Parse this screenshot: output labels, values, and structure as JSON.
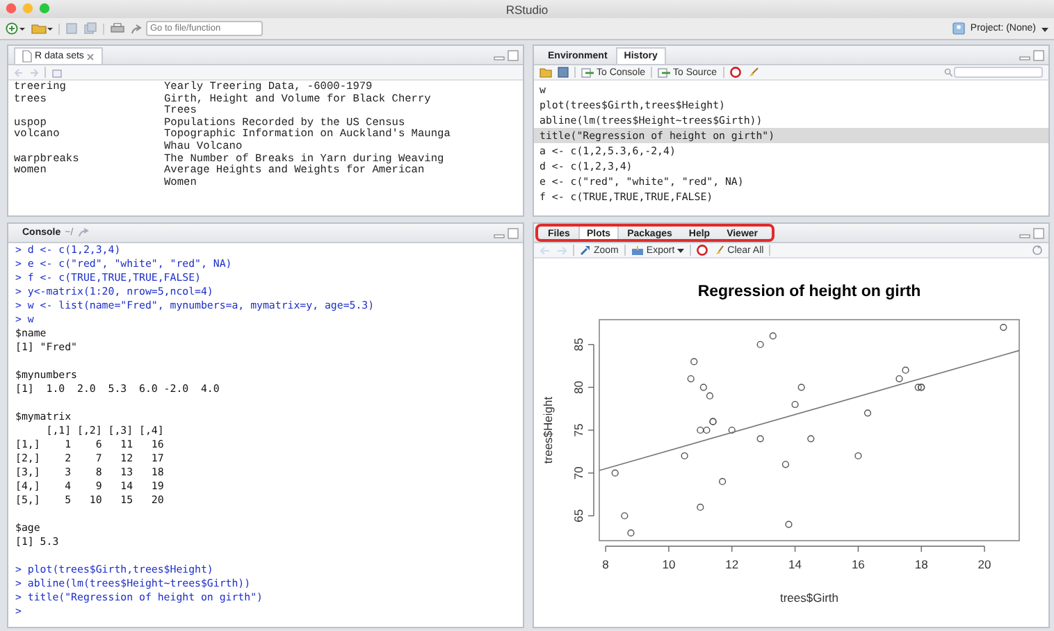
{
  "window": {
    "title": "RStudio"
  },
  "toolbar": {
    "search": {
      "placeholder": "Go to file/function"
    },
    "project": "Project: (None)"
  },
  "datasets_pane": {
    "tabs": [
      {
        "label": "R data sets",
        "selected": true
      }
    ],
    "rows": [
      {
        "name": "treering",
        "description": [
          "Yearly Treering Data, -6000-1979"
        ]
      },
      {
        "name": "trees",
        "description": [
          "Girth, Height and Volume for Black Cherry",
          "Trees"
        ]
      },
      {
        "name": "uspop",
        "description": [
          "Populations Recorded by the US Census"
        ]
      },
      {
        "name": "volcano",
        "description": [
          "Topographic Information on Auckland's Maunga",
          "Whau Volcano"
        ]
      },
      {
        "name": "warpbreaks",
        "description": [
          "The Number of Breaks in Yarn during Weaving"
        ]
      },
      {
        "name": "women",
        "description": [
          "Average Heights and Weights for American",
          "Women"
        ]
      }
    ]
  },
  "console": {
    "title": "Console",
    "path": "~/",
    "lines": [
      {
        "kind": "input",
        "text": "> d <- c(1,2,3,4)"
      },
      {
        "kind": "input",
        "text": "> e <- c(\"red\", \"white\", \"red\", NA)"
      },
      {
        "kind": "input",
        "text": "> f <- c(TRUE,TRUE,TRUE,FALSE)"
      },
      {
        "kind": "input",
        "text": "> y<-matrix(1:20, nrow=5,ncol=4)"
      },
      {
        "kind": "input",
        "text": "> w <- list(name=\"Fred\", mynumbers=a, mymatrix=y, age=5.3)"
      },
      {
        "kind": "input",
        "text": "> w"
      },
      {
        "kind": "output",
        "text": "$name"
      },
      {
        "kind": "output",
        "text": "[1] \"Fred\""
      },
      {
        "kind": "blank"
      },
      {
        "kind": "output",
        "text": "$mynumbers"
      },
      {
        "kind": "output",
        "text": "[1]  1.0  2.0  5.3  6.0 -2.0  4.0"
      },
      {
        "kind": "blank"
      },
      {
        "kind": "output",
        "text": "$mymatrix"
      },
      {
        "kind": "output",
        "text": "     [,1] [,2] [,3] [,4]"
      },
      {
        "kind": "output",
        "text": "[1,]    1    6   11   16"
      },
      {
        "kind": "output",
        "text": "[2,]    2    7   12   17"
      },
      {
        "kind": "output",
        "text": "[3,]    3    8   13   18"
      },
      {
        "kind": "output",
        "text": "[4,]    4    9   14   19"
      },
      {
        "kind": "output",
        "text": "[5,]    5   10   15   20"
      },
      {
        "kind": "blank"
      },
      {
        "kind": "output",
        "text": "$age"
      },
      {
        "kind": "output",
        "text": "[1] 5.3"
      },
      {
        "kind": "blank"
      },
      {
        "kind": "input",
        "text": "> plot(trees$Girth,trees$Height)"
      },
      {
        "kind": "input",
        "text": "> abline(lm(trees$Height~trees$Girth))"
      },
      {
        "kind": "input",
        "text": "> title(\"Regression of height on girth\")"
      },
      {
        "kind": "input",
        "text": ">"
      }
    ]
  },
  "history_pane": {
    "tabs": [
      {
        "label": "Environment",
        "selected": false
      },
      {
        "label": "History",
        "selected": true
      }
    ],
    "buttons": [
      "To Console",
      "To Source"
    ],
    "entries": [
      {
        "text": "w",
        "selected": false
      },
      {
        "text": "plot(trees$Girth,trees$Height)",
        "selected": false
      },
      {
        "text": "abline(lm(trees$Height~trees$Girth))",
        "selected": false
      },
      {
        "text": "title(\"Regression of height on girth\")",
        "selected": true
      },
      {
        "text": "a <- c(1,2,5.3,6,-2,4)",
        "selected": false
      },
      {
        "text": "d <- c(1,2,3,4)",
        "selected": false
      },
      {
        "text": "e <- c(\"red\", \"white\", \"red\", NA)",
        "selected": false
      },
      {
        "text": "f <- c(TRUE,TRUE,TRUE,FALSE)",
        "selected": false
      }
    ]
  },
  "plots_pane": {
    "tabs": [
      {
        "label": "Files",
        "selected": false
      },
      {
        "label": "Plots",
        "selected": true
      },
      {
        "label": "Packages",
        "selected": false
      },
      {
        "label": "Help",
        "selected": false
      },
      {
        "label": "Viewer",
        "selected": false
      }
    ],
    "tabs_highlighted": true,
    "buttons": [
      "Zoom",
      "Export",
      "Clear All"
    ],
    "chart_data": {
      "type": "scatter",
      "title": "Regression of height on girth",
      "xlabel": "trees$Girth",
      "ylabel": "trees$Height",
      "xlim": [
        7.8,
        21.1
      ],
      "ylim": [
        62.1,
        87.9
      ],
      "xticks": [
        {
          "value": 8,
          "label": "8"
        },
        {
          "value": 10,
          "label": "10"
        },
        {
          "value": 12,
          "label": "12"
        },
        {
          "value": 14,
          "label": "14"
        },
        {
          "value": 16,
          "label": "16"
        },
        {
          "value": 18,
          "label": "18"
        },
        {
          "value": 20,
          "label": "20"
        }
      ],
      "yticks": [
        {
          "value": 65,
          "label": "65"
        },
        {
          "value": 70,
          "label": "70"
        },
        {
          "value": 75,
          "label": "75"
        },
        {
          "value": 80,
          "label": "80"
        },
        {
          "value": 85,
          "label": "85"
        }
      ],
      "x": [
        8.3,
        8.6,
        8.8,
        10.5,
        10.7,
        10.8,
        11.0,
        11.0,
        11.1,
        11.2,
        11.3,
        11.4,
        11.4,
        11.7,
        12.0,
        12.9,
        12.9,
        13.3,
        13.7,
        13.8,
        14.0,
        14.2,
        14.5,
        16.0,
        16.3,
        17.3,
        17.5,
        17.9,
        18.0,
        18.0,
        20.6
      ],
      "series": [
        {
          "color": "#555555",
          "values": [
            70,
            65,
            63,
            72,
            81,
            83,
            66,
            75,
            80,
            75,
            79,
            76,
            76,
            69,
            75,
            74,
            85,
            86,
            71,
            64,
            78,
            80,
            74,
            72,
            77,
            81,
            82,
            80,
            80,
            80,
            87
          ]
        },
        {
          "type": "line",
          "color": "#777777",
          "x": [
            7.8,
            21.1
          ],
          "values": [
            70.3,
            84.3
          ]
        }
      ]
    }
  }
}
